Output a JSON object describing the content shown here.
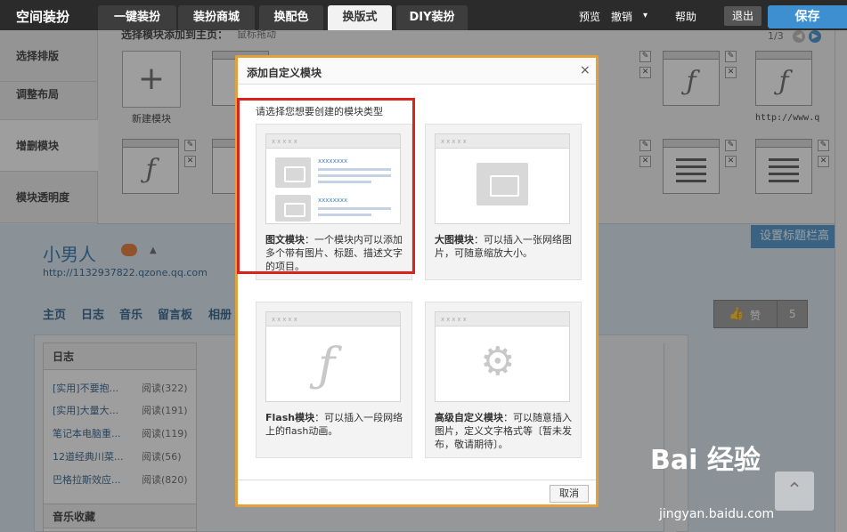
{
  "topbar": {
    "brand": "空间装扮",
    "tabs": [
      {
        "label": "一键装扮"
      },
      {
        "label": "装扮商城"
      },
      {
        "label": "换配色"
      },
      {
        "label": "换版式"
      },
      {
        "label": "DIY装扮"
      }
    ],
    "active_tab": 3,
    "preview": "预览",
    "undo": "撤销",
    "undo_caret": "▾",
    "help": "帮助",
    "exit": "退出",
    "save": "保存"
  },
  "panel": {
    "nav": [
      {
        "label": "选择排版"
      },
      {
        "label": "调整布局"
      },
      {
        "label": "增删模块"
      },
      {
        "label": "模块透明度"
      }
    ],
    "title": "选择模块添加到主页：",
    "subtitle": "鼠标拖动",
    "page_indicator": "1/3",
    "new_module": "新建模块",
    "new_module_icon": "plus-icon",
    "url_label": "http://www.q",
    "title_bar_button": "设置标题栏高"
  },
  "profile": {
    "name": "小男人",
    "url": "http://1132937822.qzone.qq.com",
    "nav": [
      "主页",
      "日志",
      "音乐",
      "留言板",
      "相册"
    ],
    "like_label": "赞",
    "like_count": "5"
  },
  "blog": {
    "header": "日志",
    "rows": [
      {
        "title": "[实用]不要抱...",
        "count": "阅读(322)"
      },
      {
        "title": "[实用]大量大...",
        "count": "阅读(191)"
      },
      {
        "title": "笔记本电脑重...",
        "count": "阅读(119)"
      },
      {
        "title": "12道经典川菜...",
        "count": "阅读(56)"
      },
      {
        "title": "巴格拉斯效应...",
        "count": "阅读(820)"
      }
    ],
    "music_header": "音乐收藏"
  },
  "dialog": {
    "title": "添加自定义模块",
    "close": "×",
    "prompt": "请选择您想要创建的模块类型",
    "cards": [
      {
        "name": "图文模块",
        "desc": "：一个模块内可以添加多个带有图片、标题、描述文字的项目。"
      },
      {
        "name": "大图模块",
        "desc": "：可以插入一张网络图片，可随意缩放大小。"
      },
      {
        "name": "Flash模块",
        "desc": "：可以插入一段网络上的flash动画。"
      },
      {
        "name": "高级自定义模块",
        "desc": "：可以随意插入图片，定义文字格式等〔暂未发布，敬请期待〕。"
      }
    ],
    "thumb_dots": "xxxxx",
    "thumb_link": "xxxxxxxx",
    "cancel": "取消"
  },
  "watermark": {
    "logo": "Bai 经验",
    "sub": "jingyan.baidu.com"
  },
  "colors": {
    "accent": "#3e8fd0",
    "highlight": "#d9241d",
    "dialog_border": "#e2a13d"
  }
}
